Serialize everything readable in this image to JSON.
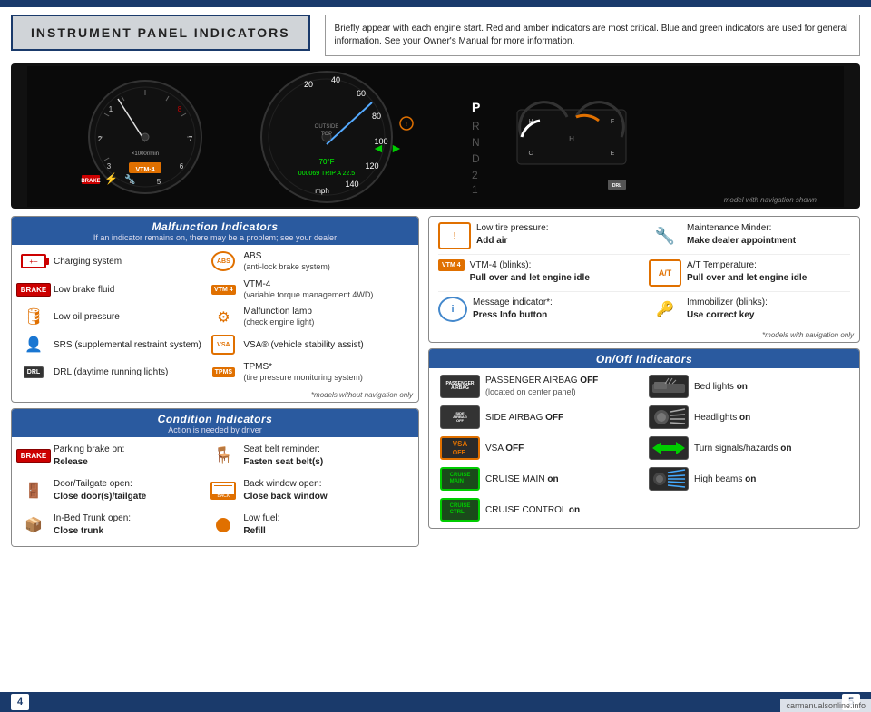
{
  "page": {
    "top_bar_color": "#1a3a6b",
    "bottom_bar_color": "#1a3a6b"
  },
  "header": {
    "title": "INSTRUMENT PANEL INDICATORS",
    "description": "Briefly appear with each engine start. Red and amber indicators are most critical. Blue and green indicators are used for general information. See your Owner's Manual for more information."
  },
  "dashboard": {
    "watermark": "model with navigation shown"
  },
  "malfunction": {
    "section_title": "Malfunction Indicators",
    "section_subtitle": "If an indicator remains on, there may be a problem; see your dealer",
    "footnote": "*models without navigation only",
    "left_items": [
      {
        "icon_type": "battery-red",
        "label": "Charging system"
      },
      {
        "icon_type": "brake-badge",
        "label": "Low brake fluid"
      },
      {
        "icon_type": "oil-amber",
        "label": "Low oil pressure"
      },
      {
        "icon_type": "srs-amber",
        "label": "SRS (supplemental restraint system)"
      },
      {
        "icon_type": "drl-badge",
        "label": "DRL (daytime running lights)"
      }
    ],
    "right_items": [
      {
        "icon_type": "abs-circle",
        "label": "ABS",
        "sublabel": "(anti-lock brake system)"
      },
      {
        "icon_type": "vtm4-badge",
        "label": "VTM-4",
        "sublabel": "(variable torque management 4WD)"
      },
      {
        "icon_type": "engine-amber",
        "label": "Malfunction lamp",
        "sublabel": "(check engine light)"
      },
      {
        "icon_type": "vsa-amber",
        "label": "VSA® (vehicle stability assist)"
      },
      {
        "icon_type": "tpms-badge",
        "label": "TPMS*",
        "sublabel": "(tire pressure monitoring system)"
      }
    ]
  },
  "condition": {
    "section_title": "Condition Indicators",
    "section_subtitle": "Action is needed by driver",
    "items": [
      {
        "icon_type": "brake-badge",
        "label": "Parking brake on:",
        "action": "Release"
      },
      {
        "icon_type": "seatbelt-amber",
        "label": "Seat belt reminder:",
        "action": "Fasten seat belt(s)"
      },
      {
        "icon_type": "door-amber",
        "label": "Door/Tailgate open:",
        "action": "Close door(s)/tailgate"
      },
      {
        "icon_type": "backwindow-amber",
        "label": "Back window open:",
        "action": "Close back window"
      },
      {
        "icon_type": "trunk-amber",
        "label": "In-Bed Trunk open:",
        "action": "Close trunk"
      },
      {
        "icon_type": "fuel-amber",
        "label": "Low fuel:",
        "action": "Refill"
      }
    ]
  },
  "right_indicators": {
    "items": [
      {
        "icon_type": "tire-amber",
        "label": "Low tire pressure:",
        "action": "Add air"
      },
      {
        "icon_type": "wrench-amber",
        "label": "Maintenance Minder:",
        "action": "Make dealer appointment"
      },
      {
        "icon_type": "vtm4-badge2",
        "label": "VTM-4 (blinks):",
        "action": "Pull over and let engine idle"
      },
      {
        "icon_type": "temp-amber",
        "label": "A/T Temperature:",
        "action": "Pull over and let engine idle"
      },
      {
        "icon_type": "info-blue",
        "label": "Message indicator*:",
        "action": "Press Info button"
      },
      {
        "icon_type": "immob-amber",
        "label": "Immobilizer (blinks):",
        "action": "Use correct key"
      }
    ],
    "footnote": "*models with navigation only"
  },
  "onoff": {
    "section_title": "On/Off Indicators",
    "items": [
      {
        "icon_type": "passenger-airbag",
        "label": "PASSENGER AIRBAG ",
        "bold": "OFF",
        "sublabel": "(located on center panel)"
      },
      {
        "icon_type": "bed-lights",
        "label": "Bed lights ",
        "bold": "on"
      },
      {
        "icon_type": "side-airbag",
        "label": "SIDE AIRBAG ",
        "bold": "OFF"
      },
      {
        "icon_type": "headlights",
        "label": "Headlights ",
        "bold": "on"
      },
      {
        "icon_type": "vsa-off",
        "label": "VSA ",
        "bold": "OFF"
      },
      {
        "icon_type": "turn-signals",
        "label": "Turn signals/hazards ",
        "bold": "on"
      },
      {
        "icon_type": "cruise-main",
        "label": "CRUISE MAIN ",
        "bold": "on"
      },
      {
        "icon_type": "high-beams",
        "label": "High beams ",
        "bold": "on"
      },
      {
        "icon_type": "cruise-control",
        "label": "CRUISE CONTROL ",
        "bold": "on",
        "wide": true
      }
    ]
  },
  "pages": {
    "left": "4",
    "right": "5"
  },
  "watermark": "carmanualsonline.info"
}
